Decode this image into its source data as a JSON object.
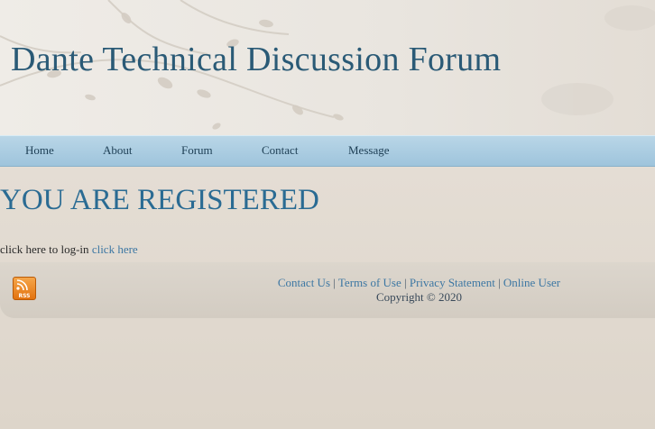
{
  "header": {
    "site_title": "Dante Technical Discussion Forum"
  },
  "nav": {
    "items": [
      {
        "label": "Home"
      },
      {
        "label": "About"
      },
      {
        "label": "Forum"
      },
      {
        "label": "Contact"
      },
      {
        "label": "Message"
      }
    ]
  },
  "main": {
    "heading": "YOU ARE REGISTERED",
    "login_prompt": "click here to log-in",
    "login_link": "click here"
  },
  "footer": {
    "rss_icon": "rss-feed-icon",
    "rss_label": "RSS",
    "links": [
      {
        "label": "Contact Us"
      },
      {
        "label": "Terms of Use"
      },
      {
        "label": "Privacy Statement"
      },
      {
        "label": "Online User"
      }
    ],
    "separator": "|",
    "copyright": "Copyright © 2020"
  },
  "colors": {
    "title": "#2a5a76",
    "nav_bar": "#a9cde2",
    "heading": "#2a6b93",
    "link": "#3d77a3",
    "rss": "#e3730f"
  }
}
